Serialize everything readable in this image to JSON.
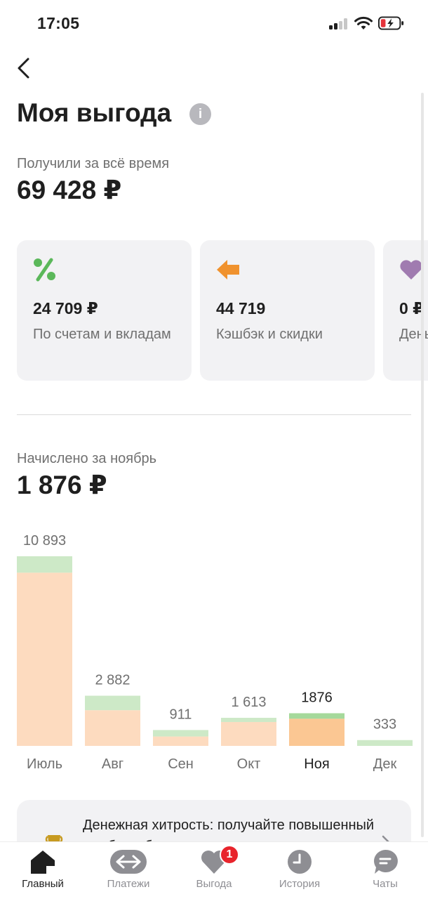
{
  "status_bar": {
    "time": "17:05"
  },
  "header": {
    "title": "Моя выгода"
  },
  "totals": {
    "label": "Получили за всё время",
    "value": "69 428 ₽"
  },
  "cards": [
    {
      "value": "24 709 ₽",
      "label": "По счетам и вкладам",
      "icon": "percent-icon",
      "color": "#5bb85a"
    },
    {
      "value": "44 719",
      "label": "Кэшбэк и скидки",
      "icon": "arrow-left-icon",
      "color": "#f0922e"
    },
    {
      "value": "0 ₽",
      "label": "Деньги от друзей",
      "icon": "heart-icon",
      "color": "#a07bb0"
    }
  ],
  "monthly": {
    "label": "Начислено за ноябрь",
    "value": "1 876 ₽"
  },
  "chart_data": {
    "type": "bar",
    "categories": [
      "Июль",
      "Авг",
      "Сен",
      "Окт",
      "Ноя",
      "Дек"
    ],
    "value_labels": [
      "10 893",
      "2 882",
      "911",
      "1 613",
      "1876",
      "333"
    ],
    "values": [
      10893,
      2882,
      911,
      1613,
      1876,
      333
    ],
    "series": [
      {
        "name": "",
        "color": "#fddbbf",
        "values": [
          9950,
          2050,
          540,
          1370,
          1560,
          0
        ]
      },
      {
        "name": "",
        "color": "#cde9c7",
        "values": [
          943,
          832,
          371,
          243,
          316,
          333
        ]
      }
    ],
    "active_category": "Ноя",
    "active_colors": [
      "#fbc793",
      "#a5d99b"
    ],
    "ylim": [
      0,
      10893
    ],
    "grid": false
  },
  "promo": {
    "text": "Денежная хитрость: получайте повышенный кэшбэк и бонусы"
  },
  "tabbar": {
    "tabs": [
      {
        "label": "Главный",
        "icon": "home-icon",
        "active": true
      },
      {
        "label": "Платежи",
        "icon": "transfer-icon",
        "active": false
      },
      {
        "label": "Выгода",
        "icon": "heart-icon",
        "active": false,
        "badge": "1"
      },
      {
        "label": "История",
        "icon": "clock-icon",
        "active": false
      },
      {
        "label": "Чаты",
        "icon": "chat-icon",
        "active": false
      }
    ]
  }
}
